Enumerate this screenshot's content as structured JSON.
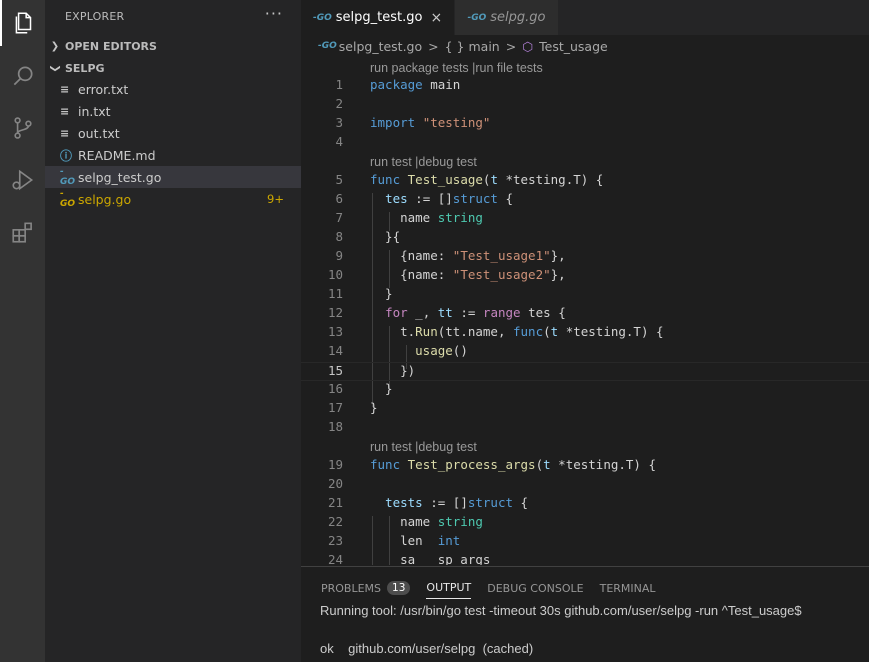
{
  "activity_bar": {
    "items": [
      "explorer-icon",
      "search-icon",
      "source-control-icon",
      "run-debug-icon",
      "extensions-icon"
    ]
  },
  "sidebar": {
    "title": "EXPLORER",
    "more": "···",
    "open_editors": "OPEN EDITORS",
    "folder": "SELPG",
    "files": [
      {
        "name": "error.txt",
        "icon": "lines"
      },
      {
        "name": "in.txt",
        "icon": "lines"
      },
      {
        "name": "out.txt",
        "icon": "lines"
      },
      {
        "name": "README.md",
        "icon": "info"
      },
      {
        "name": "selpg_test.go",
        "icon": "go"
      },
      {
        "name": "selpg.go",
        "icon": "go",
        "badge": "9+"
      }
    ]
  },
  "tabs": [
    {
      "label": "selpg_test.go",
      "active": true,
      "close": "×"
    },
    {
      "label": "selpg.go",
      "active": false
    }
  ],
  "breadcrumb": {
    "file": "selpg_test.go",
    "sep1": ">",
    "package": "{ } main",
    "sep2": ">",
    "symbol": "Test_usage"
  },
  "editor": {
    "lens1": "run package tests |run file tests",
    "lens2": "run test |debug test",
    "lens3": "run test |debug test",
    "line_numbers": [
      "1",
      "2",
      "3",
      "4",
      "5",
      "6",
      "7",
      "8",
      "9",
      "10",
      "11",
      "12",
      "13",
      "14",
      "15",
      "16",
      "17",
      "18",
      "19",
      "20",
      "21",
      "22",
      "23",
      "24"
    ]
  },
  "panel": {
    "tabs": [
      "PROBLEMS",
      "OUTPUT",
      "DEBUG CONSOLE",
      "TERMINAL"
    ],
    "problems_count": "13",
    "active_tab": "OUTPUT",
    "output_line1": "Running tool: /usr/bin/go test -timeout 30s github.com/user/selpg -run ^Test_usage$",
    "output_line2": "ok    github.com/user/selpg  (cached)"
  },
  "colors": {
    "keyword": "#569cd6",
    "control": "#c586c0",
    "string": "#ce9178",
    "function": "#dcdcaa",
    "type": "#4ec9b0",
    "variable": "#9cdcfe",
    "go_icon": "#519aba",
    "modified": "#cca700"
  }
}
